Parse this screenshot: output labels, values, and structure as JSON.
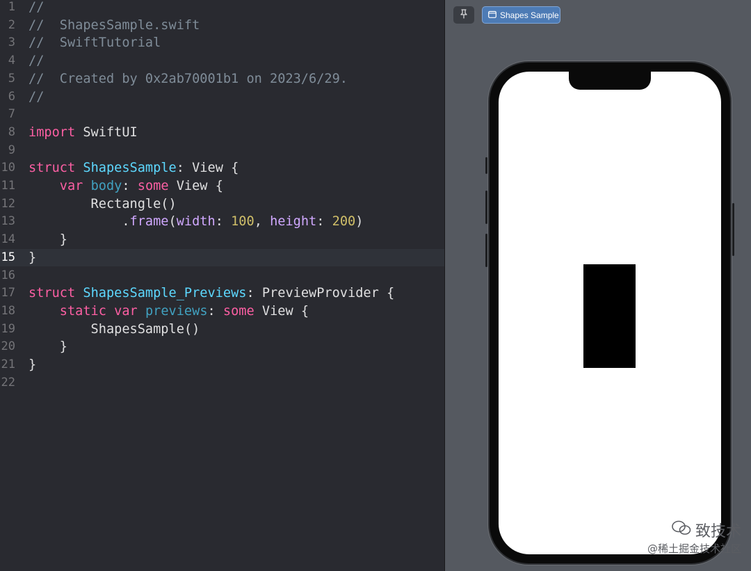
{
  "editor": {
    "current_line": 15,
    "lines": [
      {
        "n": "1",
        "tokens": [
          {
            "t": "//",
            "c": "comment"
          }
        ]
      },
      {
        "n": "2",
        "tokens": [
          {
            "t": "//  ShapesSample.swift",
            "c": "comment"
          }
        ]
      },
      {
        "n": "3",
        "tokens": [
          {
            "t": "//  SwiftTutorial",
            "c": "comment"
          }
        ]
      },
      {
        "n": "4",
        "tokens": [
          {
            "t": "//",
            "c": "comment"
          }
        ]
      },
      {
        "n": "5",
        "tokens": [
          {
            "t": "//  Created by 0x2ab70001b1 on 2023/6/29.",
            "c": "comment"
          }
        ]
      },
      {
        "n": "6",
        "tokens": [
          {
            "t": "//",
            "c": "comment"
          }
        ]
      },
      {
        "n": "7",
        "tokens": []
      },
      {
        "n": "8",
        "tokens": [
          {
            "t": "import",
            "c": "kw"
          },
          {
            "t": " SwiftUI",
            "c": "plain"
          }
        ]
      },
      {
        "n": "9",
        "tokens": []
      },
      {
        "n": "10",
        "tokens": [
          {
            "t": "struct",
            "c": "kw"
          },
          {
            "t": " ",
            "c": "plain"
          },
          {
            "t": "ShapesSample",
            "c": "type"
          },
          {
            "t": ": View {",
            "c": "plain"
          }
        ]
      },
      {
        "n": "11",
        "tokens": [
          {
            "t": "    ",
            "c": "plain"
          },
          {
            "t": "var",
            "c": "kw"
          },
          {
            "t": " ",
            "c": "plain"
          },
          {
            "t": "body",
            "c": "var"
          },
          {
            "t": ": ",
            "c": "plain"
          },
          {
            "t": "some",
            "c": "kw"
          },
          {
            "t": " View {",
            "c": "plain"
          }
        ]
      },
      {
        "n": "12",
        "tokens": [
          {
            "t": "        Rectangle()",
            "c": "plain"
          }
        ]
      },
      {
        "n": "13",
        "tokens": [
          {
            "t": "            .",
            "c": "plain"
          },
          {
            "t": "frame",
            "c": "func"
          },
          {
            "t": "(",
            "c": "plain"
          },
          {
            "t": "width",
            "c": "func"
          },
          {
            "t": ": ",
            "c": "plain"
          },
          {
            "t": "100",
            "c": "num"
          },
          {
            "t": ", ",
            "c": "plain"
          },
          {
            "t": "height",
            "c": "func"
          },
          {
            "t": ": ",
            "c": "plain"
          },
          {
            "t": "200",
            "c": "num"
          },
          {
            "t": ")",
            "c": "plain"
          }
        ]
      },
      {
        "n": "14",
        "tokens": [
          {
            "t": "    }",
            "c": "plain"
          }
        ]
      },
      {
        "n": "15",
        "tokens": [
          {
            "t": "}",
            "c": "plain"
          }
        ]
      },
      {
        "n": "16",
        "tokens": []
      },
      {
        "n": "17",
        "tokens": [
          {
            "t": "struct",
            "c": "kw"
          },
          {
            "t": " ",
            "c": "plain"
          },
          {
            "t": "ShapesSample_Previews",
            "c": "type"
          },
          {
            "t": ": PreviewProvider {",
            "c": "plain"
          }
        ]
      },
      {
        "n": "18",
        "tokens": [
          {
            "t": "    ",
            "c": "plain"
          },
          {
            "t": "static",
            "c": "kw"
          },
          {
            "t": " ",
            "c": "plain"
          },
          {
            "t": "var",
            "c": "kw"
          },
          {
            "t": " ",
            "c": "plain"
          },
          {
            "t": "previews",
            "c": "var"
          },
          {
            "t": ": ",
            "c": "plain"
          },
          {
            "t": "some",
            "c": "kw"
          },
          {
            "t": " View {",
            "c": "plain"
          }
        ]
      },
      {
        "n": "19",
        "tokens": [
          {
            "t": "        ShapesSample()",
            "c": "plain"
          }
        ]
      },
      {
        "n": "20",
        "tokens": [
          {
            "t": "    }",
            "c": "plain"
          }
        ]
      },
      {
        "n": "21",
        "tokens": [
          {
            "t": "}",
            "c": "plain"
          }
        ]
      },
      {
        "n": "22",
        "tokens": []
      }
    ]
  },
  "preview": {
    "pin_icon": "pin-icon",
    "chip_icon": "preview-device-icon",
    "chip_label": "Shapes Sample"
  },
  "watermark": {
    "line1": "致技术",
    "line2": "@稀土掘金技术社区"
  },
  "colors": {
    "editor_bg": "#292a30",
    "preview_bg": "#555960",
    "comment": "#7f8c98",
    "keyword": "#fc5fa3",
    "type": "#5dd8ff",
    "func": "#d0a8ff",
    "number": "#d0bf69",
    "accent": "#4d7bb5"
  }
}
